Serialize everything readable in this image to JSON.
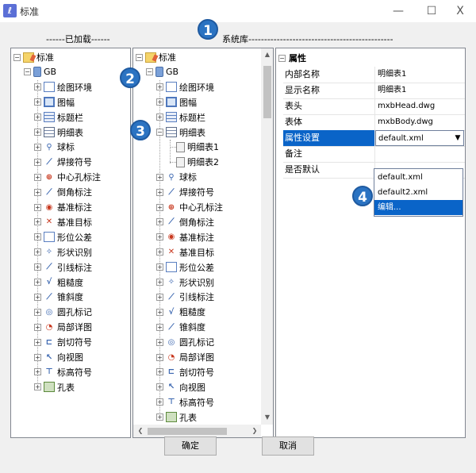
{
  "window": {
    "title": "标准",
    "minimize": "—",
    "maximize": "☐",
    "close": "X"
  },
  "loaded_group": {
    "caption": "------已加载------"
  },
  "library_group": {
    "caption": "系统库---------------------------------------------------------"
  },
  "loaded_tree": {
    "root": "标准",
    "gb": "GB",
    "items": [
      "绘图环境",
      "图幅",
      "标题栏",
      "明细表",
      "球标",
      "焊接符号",
      "中心孔标注",
      "倒角标注",
      "基准标注",
      "基准目标",
      "形位公差",
      "形状识别",
      "引线标注",
      "粗糙度",
      "锥斜度",
      "圆孔标记",
      "局部详图",
      "剖切符号",
      "向视图",
      "标高符号",
      "孔表"
    ]
  },
  "library_tree": {
    "root": "标准",
    "gb": "GB",
    "items_top": [
      "绘图环境",
      "图幅",
      "标题栏",
      "明细表"
    ],
    "mingxi_children": [
      "明细表1",
      "明细表2"
    ],
    "items_rest": [
      "球标",
      "焊接符号",
      "中心孔标注",
      "倒角标注",
      "基准标注",
      "基准目标",
      "形位公差",
      "形状识别",
      "引线标注",
      "粗糙度",
      "锥斜度",
      "圆孔标记",
      "局部详图",
      "剖切符号",
      "向视图",
      "标高符号",
      "孔表"
    ]
  },
  "properties": {
    "category": "属性",
    "rows": [
      {
        "key": "内部名称",
        "value": "明细表1"
      },
      {
        "key": "显示名称",
        "value": "明细表1"
      },
      {
        "key": "表头",
        "value": "mxbHead.dwg"
      },
      {
        "key": "表体",
        "value": "mxbBody.dwg"
      },
      {
        "key": "属性设置",
        "value": "default.xml"
      },
      {
        "key": "备注",
        "value": ""
      },
      {
        "key": "是否默认",
        "value": ""
      }
    ],
    "dropdown_options": [
      "default.xml",
      "default2.xml",
      "编辑..."
    ]
  },
  "buttons": {
    "ok": "确定",
    "cancel": "取消"
  },
  "badges": [
    "1",
    "2",
    "3",
    "4"
  ]
}
